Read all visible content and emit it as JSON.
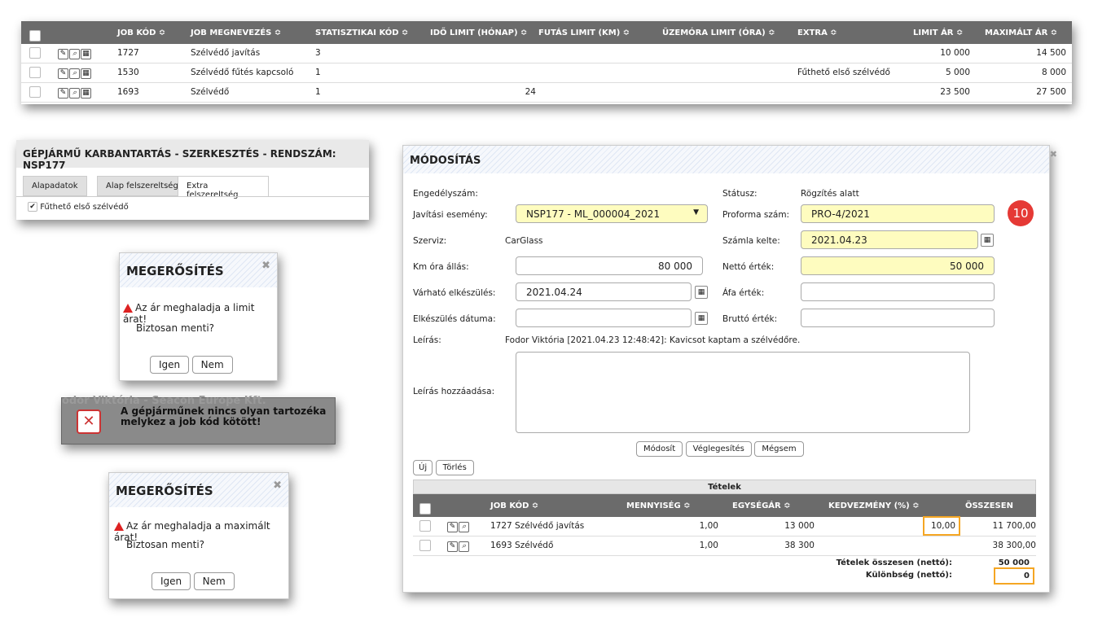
{
  "top_table": {
    "headers": [
      "JOB KÓD ≎",
      "JOB MEGNEVEZÉS ≎",
      "STATISZTIKAI KÓD ≎",
      "IDŐ LIMIT (HÓNAP) ≎",
      "FUTÁS LIMIT (KM) ≎",
      "ÜZEMÓRA LIMIT (ÓRA) ≎",
      "EXTRA ≎",
      "LIMIT ÁR ≎",
      "MAXIMÁLT ÁR ≎"
    ],
    "rows": [
      {
        "code": "1727",
        "name": "Szélvédő javítás",
        "stat": "3",
        "time": "",
        "run": "",
        "hours": "",
        "extra": "",
        "limit": "10 000",
        "max": "14 500"
      },
      {
        "code": "1530",
        "name": "Szélvédő fűtés kapcsoló",
        "stat": "1",
        "time": "",
        "run": "",
        "hours": "",
        "extra": "Fűthető első szélvédő",
        "limit": "5 000",
        "max": "8 000"
      },
      {
        "code": "1693",
        "name": "Szélvédő",
        "stat": "1",
        "time": "24",
        "run": "",
        "hours": "",
        "extra": "",
        "limit": "23 500",
        "max": "27 500"
      }
    ]
  },
  "edit_panel": {
    "title": "GÉPJÁRMŰ KARBANTARTÁS - SZERKESZTÉS - RENDSZÁM: NSP177",
    "tabs": [
      "Alapadatok",
      "Alap felszereltség",
      "Extra felszereltség"
    ],
    "checkbox_label": "Fűthető első szélvédő"
  },
  "confirm1": {
    "title": "MEGERŐSÍTÉS",
    "message": "Az ár meghaladja a limit árat!",
    "question": "Biztosan menti?",
    "yes": "Igen",
    "no": "Nem"
  },
  "confirm2": {
    "title": "MEGERŐSÍTÉS",
    "message": "Az ár meghaladja a maximált árat!",
    "question": "Biztosan menti?",
    "yes": "Igen",
    "no": "Nem"
  },
  "error_toast": {
    "bg_text": "odor Viktória - Seacon Europe Kft.",
    "line1": "A gépjárműnek nincs olyan tartozéka",
    "line2": "melykez a job kód kötött!"
  },
  "modify": {
    "title": "MÓDOSÍTÁS",
    "badge": "10",
    "labels": {
      "permit": "Engedélyszám:",
      "repair_event": "Javítási esemény:",
      "service": "Szerviz:",
      "km": "Km óra állás:",
      "expected": "Várható elkészülés:",
      "completed": "Elkészülés dátuma:",
      "desc": "Leírás:",
      "add_desc": "Leírás hozzáadása:",
      "status": "Státusz:",
      "proforma": "Proforma szám:",
      "invoice_date": "Számla kelte:",
      "net": "Nettó érték:",
      "vat": "Áfa érték:",
      "gross": "Bruttó érték:"
    },
    "values": {
      "repair_event": "NSP177 - ML_000004_2021",
      "service": "CarGlass",
      "km": "80 000",
      "expected": "2021.04.24",
      "completed": "",
      "desc": "Fodor Viktória [2021.04.23 12:48:42]: Kavicsot kaptam a szélvédőre.",
      "status": "Rögzítés alatt",
      "proforma": "PRO-4/2021",
      "invoice_date": "2021.04.23",
      "net": "50 000",
      "vat": "",
      "gross": ""
    },
    "buttons": {
      "modify": "Módosít",
      "finalize": "Véglegesítés",
      "cancel": "Mégsem",
      "new": "Új",
      "delete": "Törlés"
    },
    "items_title": "Tételek",
    "items_headers": [
      "JOB KÓD ≎",
      "MENNYISÉG ≎",
      "EGYSÉGÁR ≎",
      "KEDVEZMÉNY (%) ≎",
      "ÖSSZESEN"
    ],
    "items": [
      {
        "job": "1727 Szélvédő javítás",
        "qty": "1,00",
        "unit": "13 000",
        "disc": "10,00",
        "total": "11 700,00"
      },
      {
        "job": "1693 Szélvédő",
        "qty": "1,00",
        "unit": "38 300",
        "disc": "",
        "total": "38 300,00"
      }
    ],
    "sum_label": "Tételek összesen (nettó):",
    "sum_value": "50 000",
    "diff_label": "Különbség (nettó):",
    "diff_value": "0"
  }
}
